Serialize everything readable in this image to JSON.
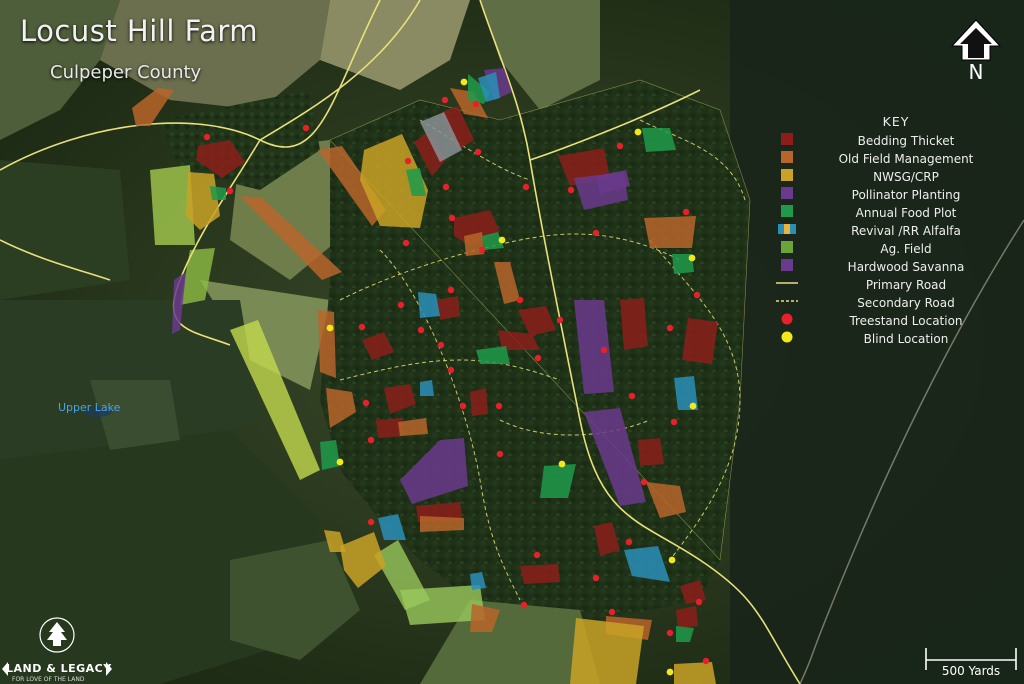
{
  "title": "Locust Hill Farm",
  "subtitle": "Culpeper County",
  "north_label": "N",
  "key": {
    "title": "KEY",
    "items": [
      {
        "label": "Bedding Thicket",
        "color": "#8b1e1a",
        "symbol": "swatch"
      },
      {
        "label": "Old Field Management",
        "color": "#b8652a",
        "symbol": "swatch"
      },
      {
        "label": "NWSG/CRP",
        "color": "#c9a226",
        "symbol": "swatch"
      },
      {
        "label": "Pollinator Planting",
        "color": "#6a3a8c",
        "symbol": "swatch"
      },
      {
        "label": "Annual Food Plot",
        "color": "#1f9a4a",
        "symbol": "swatch"
      },
      {
        "label": "Revival /RR Alfalfa",
        "color": "#2a8fb8",
        "symbol": "swatch"
      },
      {
        "label": "Ag. Field",
        "color": "#6aa53a",
        "symbol": "swatch"
      },
      {
        "label": "Hardwood Savanna",
        "color": "#6a3a8c",
        "symbol": "swatch"
      },
      {
        "label": "Primary Road",
        "color": "#e8e07a",
        "symbol": "line"
      },
      {
        "label": "Secondary Road",
        "color": "#e8e07a",
        "symbol": "dashed"
      },
      {
        "label": "Treestand Location",
        "color": "#e8202a",
        "symbol": "dot"
      },
      {
        "label": "Blind Location",
        "color": "#f2e81a",
        "symbol": "dot"
      }
    ]
  },
  "lake_label": "Upper Lake",
  "scale_label": "500 Yards",
  "logo": {
    "name": "LAND & LEGACY",
    "tagline": "FOR LOVE OF THE LAND"
  }
}
